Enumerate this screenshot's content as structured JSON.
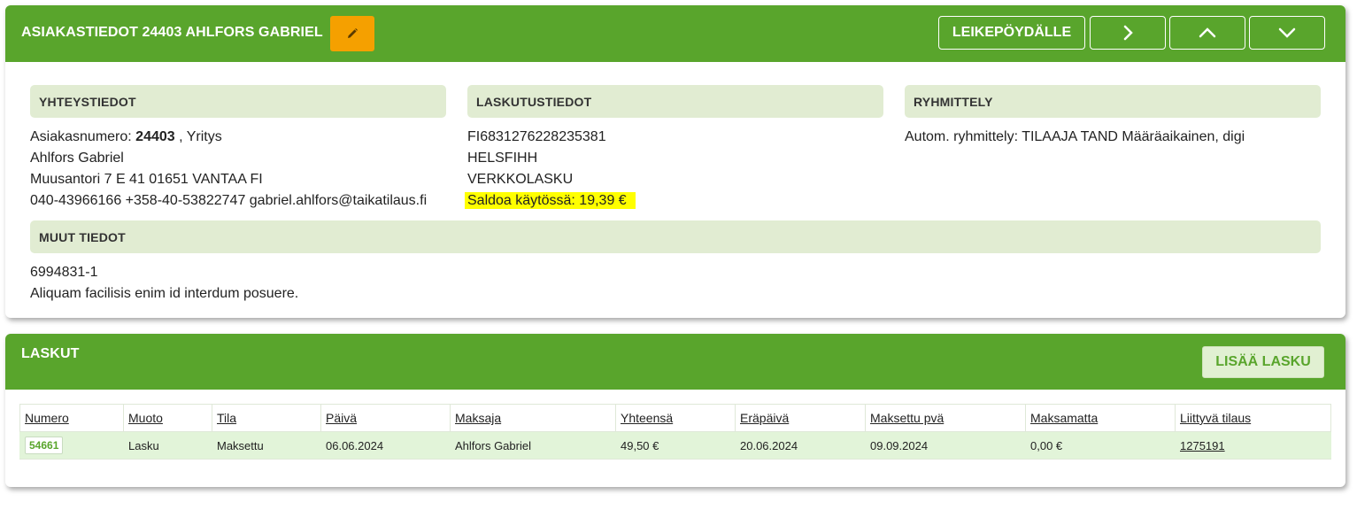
{
  "customer": {
    "title": "ASIAKASTIEDOT 24403 AHLFORS GABRIEL",
    "buttons": {
      "clipboard": "LEIKEPÖYDÄLLE"
    },
    "contact": {
      "heading": "YHTEYSTIEDOT",
      "number_prefix": "Asiakasnumero: ",
      "number": "24403",
      "number_suffix": " , Yritys",
      "name": "Ahlfors Gabriel",
      "address": "Muusantori 7 E 41 01651 VANTAA FI",
      "phones_email": "040-43966166 +358-40-53822747 gabriel.ahlfors@taikatilaus.fi"
    },
    "billing": {
      "heading": "LASKUTUSTIEDOT",
      "iban": "FI6831276228235381",
      "bic": "HELSFIHH",
      "method": "VERKKOLASKU",
      "balance": "Saldoa käytössä: 19,39 €"
    },
    "grouping": {
      "heading": "RYHMITTELY",
      "text": "Autom. ryhmittely: TILAAJA TAND Määräaikainen, digi"
    },
    "other": {
      "heading": "MUUT TIEDOT",
      "line1": "6994831-1",
      "line2": "Aliquam facilisis enim id interdum posuere."
    }
  },
  "invoices": {
    "title": "LASKUT",
    "add_button": "LISÄÄ LASKU",
    "columns": [
      "Numero",
      "Muoto",
      "Tila",
      "Päivä",
      "Maksaja",
      "Yhteensä",
      "Eräpäivä",
      "Maksettu pvä",
      "Maksamatta",
      "Liittyvä tilaus"
    ],
    "rows": [
      {
        "numero": "54661",
        "muoto": "Lasku",
        "tila": "Maksettu",
        "paiva": "06.06.2024",
        "maksaja": "Ahlfors Gabriel",
        "yhteensa": "49,50 €",
        "erapaiva": "20.06.2024",
        "maksettu": "09.09.2024",
        "maksamatta": "0,00 €",
        "tilaus": "1275191"
      }
    ]
  },
  "colors": {
    "header_green": "#59a52c",
    "section_bg": "#e1ecd2",
    "edit_orange": "#f5a000",
    "highlight_yellow": "#ffff00",
    "row_bg": "#e2f4d9"
  },
  "icons": {
    "edit": "pencil-icon",
    "next": "chevron-right-icon",
    "up": "chevron-up-icon",
    "down": "chevron-down-icon"
  }
}
